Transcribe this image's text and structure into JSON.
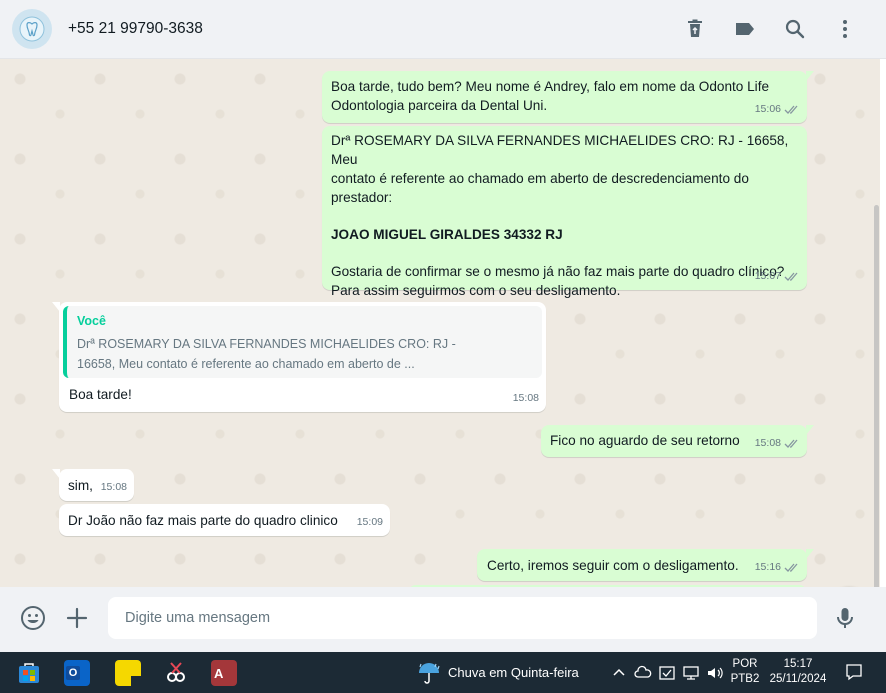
{
  "header": {
    "contact_name": "+55 21 99790-3638",
    "icons": [
      "delete-icon",
      "label-icon",
      "search-icon",
      "menu-icon"
    ]
  },
  "messages": [
    {
      "type": "outgoing",
      "lines": [
        "Boa tarde, tudo bem? Meu nome é Andrey, falo em nome da Odonto Life",
        "Odontologia parceira da Dental Uni."
      ],
      "time": "15:06"
    },
    {
      "type": "outgoing",
      "lines": [
        "Drª ROSEMARY DA SILVA FERNANDES MICHAELIDES CRO: RJ - 16658, Meu",
        "contato é referente ao chamado em aberto de descredenciamento do",
        "prestador:"
      ],
      "bold": "JOAO MIGUEL GIRALDES 34332 RJ",
      "lines2": [
        "Gostaria de confirmar se o mesmo já não faz mais parte do quadro clínico?",
        "Para assim seguirmos com o seu desligamento."
      ],
      "time": "15:07"
    },
    {
      "type": "incoming",
      "quote_author": "Você",
      "quote_lines": [
        "Drª ROSEMARY DA SILVA FERNANDES MICHAELIDES CRO: RJ -",
        "16658, Meu contato é referente ao chamado em aberto de ..."
      ],
      "text": "Boa tarde!",
      "time": "15:08"
    },
    {
      "type": "outgoing",
      "text": "Fico no aguardo de seu retorno",
      "time": "15:08"
    },
    {
      "type": "incoming",
      "text": "sim,",
      "time": "15:08"
    },
    {
      "type": "incoming",
      "text": "Dr João não faz mais parte do quadro clinico",
      "time": "15:09"
    },
    {
      "type": "outgoing",
      "text": "Certo, iremos seguir com o desligamento.",
      "time": "15:16"
    }
  ],
  "composer": {
    "placeholder": "Digite uma mensagem"
  },
  "taskbar": {
    "weather": "Chuva em Quinta-feira",
    "lang_top": "POR",
    "lang_bottom": "PTB2",
    "time": "15:17",
    "date": "25/11/2024"
  },
  "colors": {
    "outgoing_bubble": "#d9fdd3",
    "incoming_bubble": "#ffffff",
    "chat_background": "#efeae2",
    "quote_accent": "#06cf9c",
    "taskbar": "#1c2a35"
  }
}
